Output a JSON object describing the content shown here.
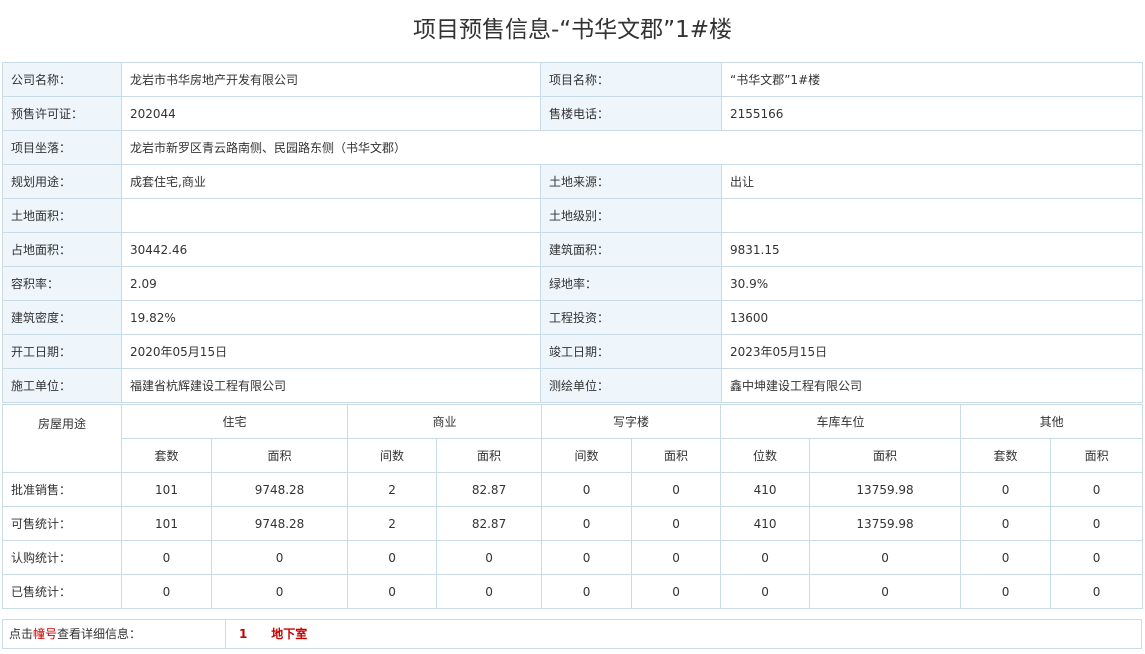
{
  "page": {
    "title": "项目预售信息-“书华文郡”1#楼"
  },
  "info": [
    {
      "l1": "公司名称：",
      "v1": "龙岩市书华房地产开发有限公司",
      "l2": "项目名称：",
      "v2": " “书华文郡”1#楼"
    },
    {
      "l1": "预售许可证：",
      "v1": "202044",
      "l2": "售楼电话：",
      "v2": "2155166"
    },
    {
      "l1": "项目坐落：",
      "v1": "龙岩市新罗区青云路南侧、民园路东侧（书华文郡）"
    },
    {
      "l1": "规划用途：",
      "v1": "成套住宅,商业",
      "l2": "土地来源：",
      "v2": "出让"
    },
    {
      "l1": "土地面积：",
      "v1": "",
      "l2": "土地级别：",
      "v2": ""
    },
    {
      "l1": "占地面积：",
      "v1": "30442.46",
      "l2": "建筑面积：",
      "v2": "9831.15"
    },
    {
      "l1": "容积率：",
      "v1": "2.09",
      "l2": "绿地率：",
      "v2": "30.9%"
    },
    {
      "l1": "建筑密度：",
      "v1": "19.82%",
      "l2": "工程投资：",
      "v2": "13600"
    },
    {
      "l1": "开工日期：",
      "v1": "2020年05月15日",
      "l2": "竣工日期：",
      "v2": "2023年05月15日"
    },
    {
      "l1": "施工单位：",
      "v1": "福建省杭辉建设工程有限公司",
      "l2": "测绘单位：",
      "v2": "鑫中坤建设工程有限公司"
    }
  ],
  "stats": {
    "corner": "房屋用途",
    "groups": [
      "住宅",
      "商业",
      "写字楼",
      "车库车位",
      "其他"
    ],
    "subheaders": [
      "套数",
      "面积",
      "间数",
      "面积",
      "间数",
      "面积",
      "位数",
      "面积",
      "套数",
      "面积"
    ],
    "rows": [
      {
        "label": "批准销售：",
        "values": [
          "101",
          "9748.28",
          "2",
          "82.87",
          "0",
          "0",
          "410",
          "13759.98",
          "0",
          "0"
        ]
      },
      {
        "label": "可售统计：",
        "values": [
          "101",
          "9748.28",
          "2",
          "82.87",
          "0",
          "0",
          "410",
          "13759.98",
          "0",
          "0"
        ]
      },
      {
        "label": "认购统计：",
        "values": [
          "0",
          "0",
          "0",
          "0",
          "0",
          "0",
          "0",
          "0",
          "0",
          "0"
        ]
      },
      {
        "label": "已售统计：",
        "values": [
          "0",
          "0",
          "0",
          "0",
          "0",
          "0",
          "0",
          "0",
          "0",
          "0"
        ]
      }
    ]
  },
  "linkbar": {
    "prefix": "点击",
    "keyword": "幢号",
    "suffix": "查看详细信息：",
    "links": [
      "1",
      "地下室"
    ]
  }
}
